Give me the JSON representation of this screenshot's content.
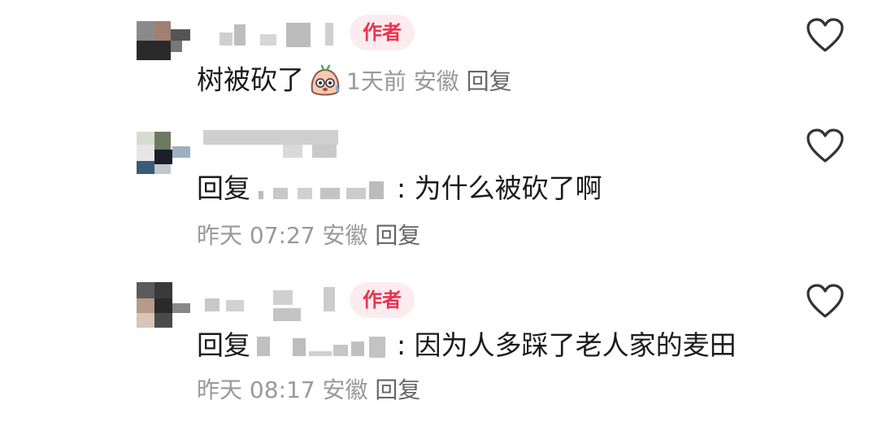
{
  "comments": [
    {
      "author_badge": "作者",
      "text": "树被砍了",
      "emoji_icon": "sweating-face-emoji-icon",
      "time": "1天前",
      "location": "安徽",
      "reply_label": "回复"
    },
    {
      "reply_prefix": "回复",
      "text": ": 为什么被砍了啊",
      "time": "昨天 07:27",
      "location": "安徽",
      "reply_label": "回复"
    },
    {
      "author_badge": "作者",
      "reply_prefix": "回复",
      "text": ": 因为人多踩了老人家的麦田",
      "time": "昨天 08:17",
      "location": "安徽",
      "reply_label": "回复"
    }
  ],
  "colors": {
    "badge_bg": "#fdecef",
    "badge_text": "#e8334f",
    "meta_text": "#999999",
    "body_text": "#1a1a1a"
  },
  "icons": {
    "like": "heart-outline-icon"
  }
}
